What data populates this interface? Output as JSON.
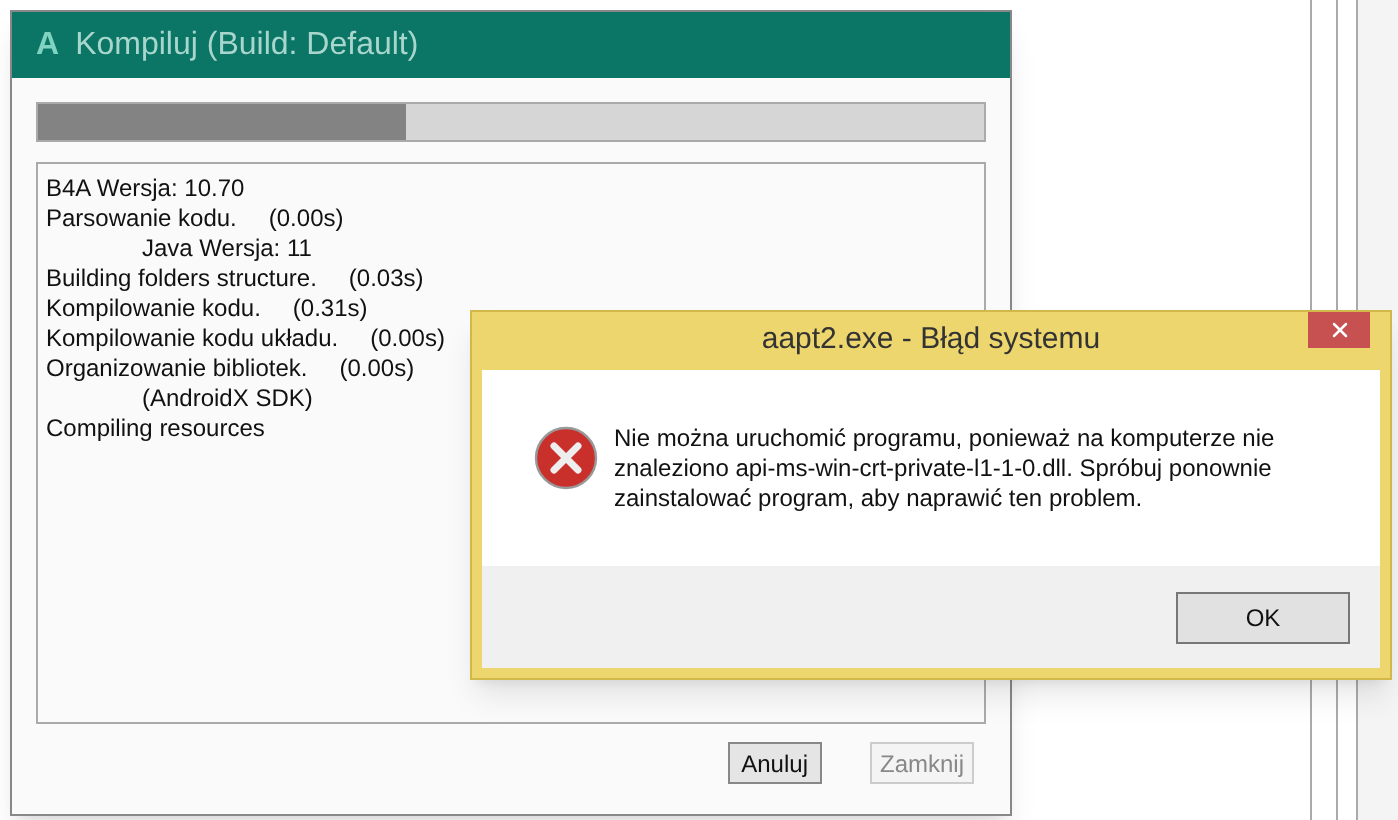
{
  "build_window": {
    "icon_letter": "A",
    "title": "Kompiluj (Build: Default)",
    "progress": {
      "level": 0.39
    },
    "log": [
      {
        "text": "B4A Wersja: 10.70"
      },
      {
        "text": "Parsowanie kodu.",
        "time": "(0.00s)",
        "children": [
          {
            "text": "Java Wersja: 11"
          }
        ]
      },
      {
        "text": "Building folders structure.",
        "time": "(0.03s)"
      },
      {
        "text": "Kompilowanie kodu.",
        "time": "(0.31s)"
      },
      {
        "text": "Kompilowanie kodu układu.",
        "time": "(0.00s)"
      },
      {
        "text": "Organizowanie bibliotek.",
        "time": "(0.00s)",
        "children": [
          {
            "text": "(AndroidX SDK)"
          }
        ]
      },
      {
        "text": "Compiling resources"
      }
    ],
    "buttons": [
      {
        "label": "Anuluj",
        "disabled": false
      },
      {
        "label": "Zamknij",
        "disabled": true
      }
    ]
  },
  "error_dialog": {
    "title": "aapt2.exe - Błąd systemu",
    "message": "Nie można uruchomić programu, ponieważ na komputerze nie znaleziono api-ms-win-crt-private-l1-1-0.dll. Spróbuj ponownie zainstalować program, aby naprawić ten problem.",
    "button": "OK"
  }
}
